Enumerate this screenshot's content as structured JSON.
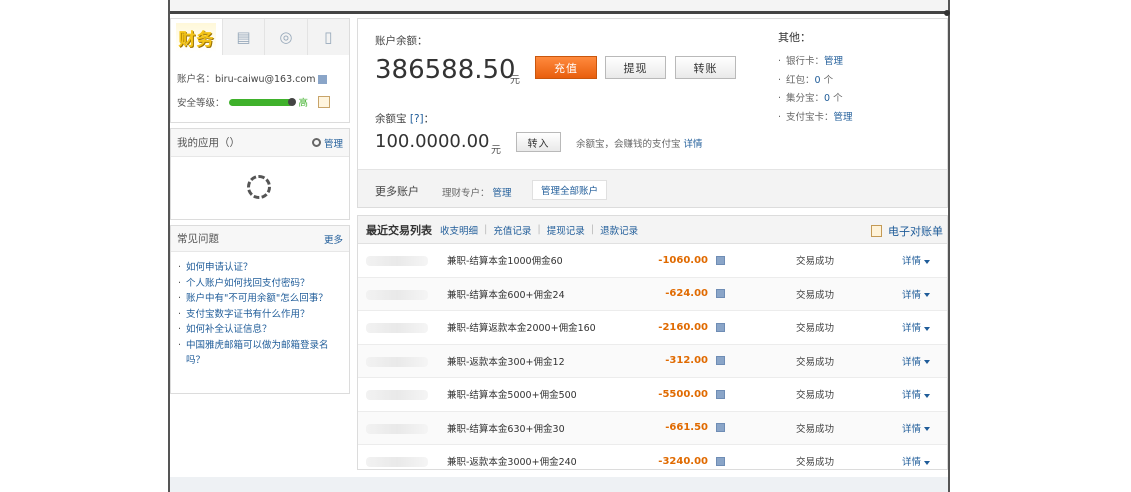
{
  "sidebar": {
    "logo": "财务",
    "tabs": [
      "财务",
      "账单",
      "保险",
      "手机"
    ],
    "account_label": "账户名：",
    "account_email": "biru-caiwu@163.com",
    "security_label": "安全等级：",
    "security_level": "高",
    "apps_title": "我的应用（）",
    "apps_manage": "管理",
    "faq_title": "常见问题",
    "faq_more": "更多",
    "faq_items": [
      "如何申请认证？",
      "个人账户如何找回支付密码？",
      "账户中有\"不可用余额\"怎么回事？",
      "支付宝数字证书有什么作用？",
      "如何补全认证信息？",
      "中国雅虎邮箱可以做为邮箱登录名吗？"
    ]
  },
  "balance": {
    "label": "账户余额：",
    "amount": "386588.50",
    "unit": "元",
    "btn_recharge": "充值",
    "btn_withdraw": "提现",
    "btn_transfer": "转账",
    "yeb_label": "余额宝",
    "yeb_help": "[?]",
    "yeb_colon": "：",
    "yeb_amount": "100.0000.00",
    "yeb_unit": "元",
    "yeb_btn": "转入",
    "yeb_note": "余额宝，会赚钱的支付宝",
    "yeb_detail": "详情",
    "more_title": "更多账户",
    "more_sub": "理财专户：",
    "more_manage": "管理",
    "more_btn": "管理全部账户"
  },
  "others": {
    "title": "其他：",
    "items": [
      {
        "label": "银行卡：",
        "value": "管理"
      },
      {
        "label": "红包：",
        "value": "0",
        "suffix": " 个"
      },
      {
        "label": "集分宝：",
        "value": "0",
        "suffix": " 个"
      },
      {
        "label": "支付宝卡：",
        "value": "管理"
      }
    ]
  },
  "transactions": {
    "title": "最近交易列表",
    "tabs": [
      "收支明细",
      "充值记录",
      "提现记录",
      "退款记录"
    ],
    "statement": "电子对账单",
    "rows": [
      {
        "name": "兼职-结算本金1000佣金60",
        "amount": "-1060.00",
        "status": "交易成功",
        "detail": "详情"
      },
      {
        "name": "兼职-结算本金600+佣金24",
        "amount": "-624.00",
        "status": "交易成功",
        "detail": "详情"
      },
      {
        "name": "兼职-结算返款本金2000+佣金160",
        "amount": "-2160.00",
        "status": "交易成功",
        "detail": "详情"
      },
      {
        "name": "兼职-返款本金300+佣金12",
        "amount": "-312.00",
        "status": "交易成功",
        "detail": "详情"
      },
      {
        "name": "兼职-结算本金5000+佣金500",
        "amount": "-5500.00",
        "status": "交易成功",
        "detail": "详情"
      },
      {
        "name": "兼职-结算本金630+佣金30",
        "amount": "-661.50",
        "status": "交易成功",
        "detail": "详情"
      },
      {
        "name": "兼职-返款本金3000+佣金240",
        "amount": "-3240.00",
        "status": "交易成功",
        "detail": "详情"
      }
    ]
  }
}
